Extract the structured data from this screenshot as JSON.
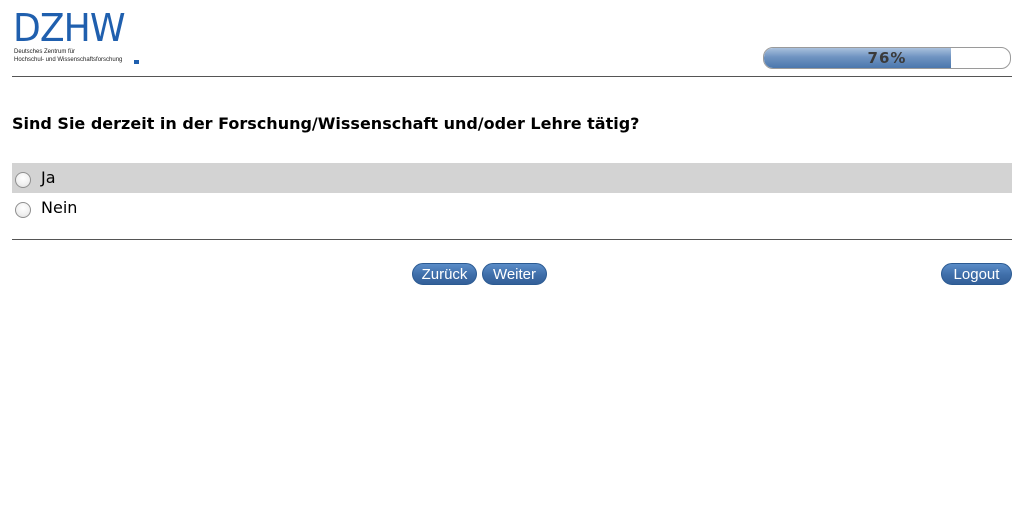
{
  "logo": {
    "mark": "DZHW",
    "subtitle_line1": "Deutsches Zentrum für",
    "subtitle_line2": "Hochschul- und Wissenschaftsforschung",
    "brand_color": "#1f5fae"
  },
  "progress": {
    "value": 0.76,
    "label": "76%",
    "fill_color": "#4b77ad"
  },
  "question": {
    "text": "Sind Sie derzeit in der Forschung/Wissenschaft und/oder Lehre tätig?"
  },
  "options": [
    {
      "label": "Ja",
      "selected": false,
      "highlighted": true
    },
    {
      "label": "Nein",
      "selected": false,
      "highlighted": false
    }
  ],
  "buttons": {
    "back_label": "Zurück",
    "next_label": "Weiter",
    "logout_label": "Logout",
    "button_color": "#3f6ea9"
  }
}
